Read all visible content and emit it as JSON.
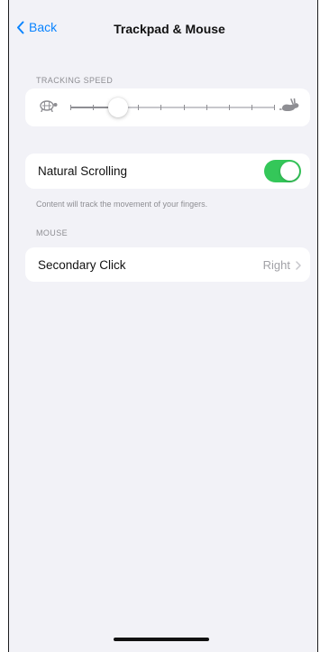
{
  "nav": {
    "back_label": "Back",
    "title": "Trackpad & Mouse"
  },
  "tracking_speed": {
    "header": "TRACKING SPEED",
    "value_fraction": 0.1,
    "tick_count": 10,
    "slow_icon": "tortoise-icon",
    "fast_icon": "hare-icon"
  },
  "natural_scrolling": {
    "label": "Natural Scrolling",
    "enabled": true,
    "footer": "Content will track the movement of your fingers."
  },
  "mouse": {
    "header": "MOUSE",
    "secondary_click_label": "Secondary Click",
    "secondary_click_value": "Right"
  },
  "colors": {
    "accent": "#0a84ff",
    "toggle_on": "#34c759",
    "background": "#f2f2f7"
  }
}
